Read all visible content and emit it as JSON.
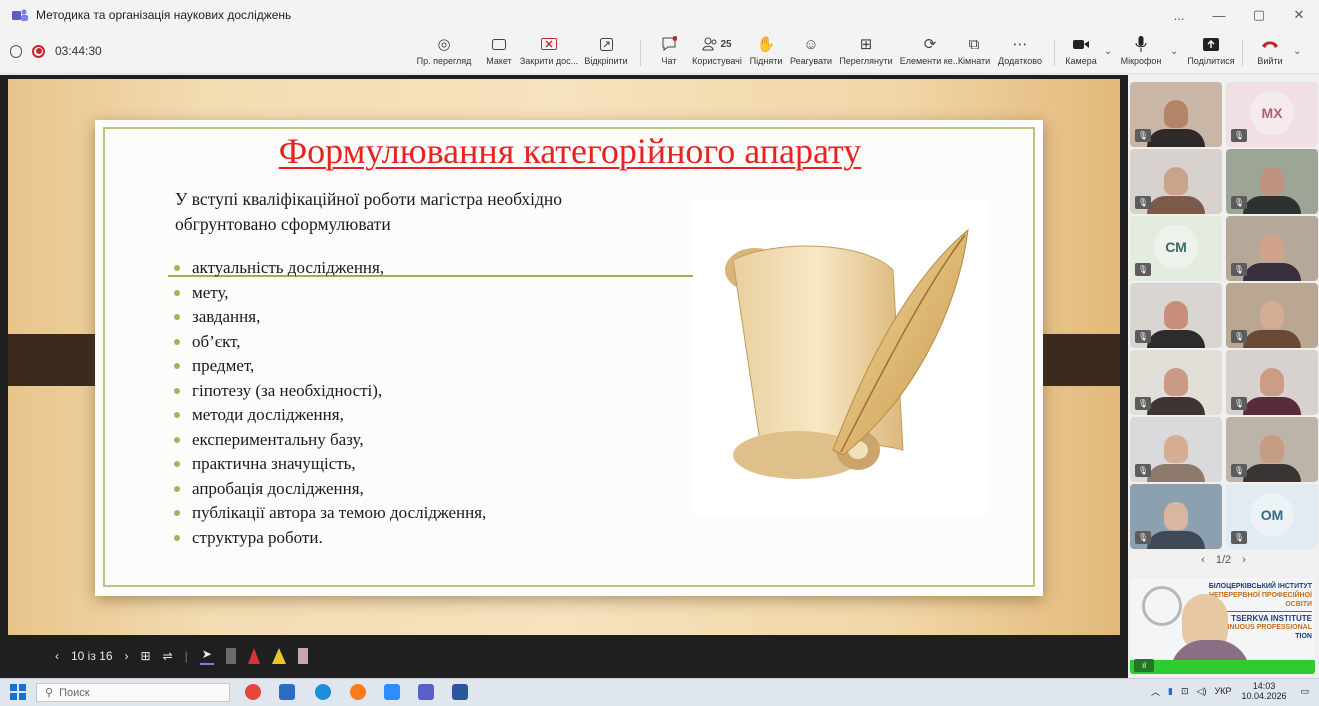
{
  "window": {
    "title": "Методика та організація наукових досліджень",
    "controls": [
      "...",
      "—",
      "▢",
      "✕"
    ]
  },
  "recording": {
    "timer": "03:44:30"
  },
  "toolbar": {
    "preview": "Пр. перегляд",
    "layout": "Макет",
    "close_doc": "Закрити дос...",
    "unpin": "Відкріпити",
    "chat": "Чат",
    "users_count": "25",
    "users": "Користувачі",
    "raise": "Підняти",
    "react": "Реагувати",
    "view": "Переглянути",
    "elements": "Елементи ке...",
    "rooms": "Кімнати",
    "more": "Додатково",
    "camera": "Камера",
    "mic": "Мікрофон",
    "share": "Поділитися",
    "leave": "Вийти"
  },
  "slide": {
    "title": "Формулювання категорійного апарату",
    "intro": "У вступі кваліфікаційної роботи магістра необхідно обгрунтовано сформулювати",
    "bullets": [
      "актуальність дослідження,",
      "мету,",
      "завдання,",
      "об’єкт,",
      "предмет,",
      "гіпотезу (за необхідності),",
      "методи дослідження,",
      "експериментальну базу,",
      "практична значущість,",
      "апробація дослідження,",
      "публікації автора за темою дослідження,",
      "структура роботи."
    ]
  },
  "slide_controls": {
    "page": "10 із 16"
  },
  "participants": {
    "tiles": [
      {
        "type": "video",
        "bg": "#c9b6a6",
        "skin": "#b58466",
        "cloth": "#2f2a2a"
      },
      {
        "type": "initials",
        "text": "МХ",
        "bg": "#f0e0e4",
        "fg": "#b65f6f"
      },
      {
        "type": "video",
        "bg": "#d8d2cf",
        "skin": "#caa38c",
        "cloth": "#7b5a4a"
      },
      {
        "type": "video",
        "bg": "#9ca596",
        "skin": "#c09280",
        "cloth": "#2f3030"
      },
      {
        "type": "initials",
        "text": "СМ",
        "bg": "#e3ecdf",
        "fg": "#3b6b66"
      },
      {
        "type": "video",
        "bg": "#b6a898",
        "skin": "#d2a38c",
        "cloth": "#3a2f3c"
      },
      {
        "type": "video",
        "bg": "#d9d6d1",
        "skin": "#c98f7a",
        "cloth": "#2c2c2c"
      },
      {
        "type": "video",
        "bg": "#b9a792",
        "skin": "#d4ab93",
        "cloth": "#6b4937"
      },
      {
        "type": "video",
        "bg": "#e2ded8",
        "skin": "#c99b86",
        "cloth": "#3e3533"
      },
      {
        "type": "video",
        "bg": "#d8d2ce",
        "skin": "#cc9c86",
        "cloth": "#5a2b3a"
      },
      {
        "type": "video",
        "bg": "#dad9dc",
        "skin": "#d7ad93",
        "cloth": "#8e7a6c"
      },
      {
        "type": "video",
        "bg": "#bcb4a8",
        "skin": "#c79c84",
        "cloth": "#3a3534"
      },
      {
        "type": "video",
        "bg": "#8da0b0",
        "skin": "#d8b6a0",
        "cloth": "#3f4a58"
      },
      {
        "type": "initials",
        "text": "ОМ",
        "bg": "#e2ebf1",
        "fg": "#2e6c89"
      }
    ],
    "pager": "1/2",
    "presenter_banner": {
      "line1": "БІЛОЦЕРКІВСЬКИЙ ІНСТИТУТ",
      "line2": "НЕПЕРЕРВНОЇ ПРОФЕСІЙНОЇ ОСВІТИ",
      "line3": "TSERKVA INSTITUTE",
      "line4": "NTINUOUS PROFESSIONAL",
      "line5": "TION"
    }
  },
  "taskbar": {
    "search": "Поиск",
    "apps": [
      {
        "name": "chrome-icon",
        "color": "#e8453c"
      },
      {
        "name": "files-icon",
        "color": "#2b6cc4"
      },
      {
        "name": "edge-icon",
        "color": "#1a8fd8"
      },
      {
        "name": "firefox-icon",
        "color": "#ff7a1a"
      },
      {
        "name": "zoom-icon",
        "color": "#2d8cff"
      },
      {
        "name": "teams-icon",
        "color": "#5a5fc7"
      },
      {
        "name": "word-icon",
        "color": "#2b579a"
      }
    ],
    "lang": "УКР",
    "time": "14:03",
    "date": "10.04.2026"
  },
  "colors": {
    "title_red": "#e8231f",
    "accent_green": "#a3b45a",
    "leave_red": "#c4262e"
  }
}
